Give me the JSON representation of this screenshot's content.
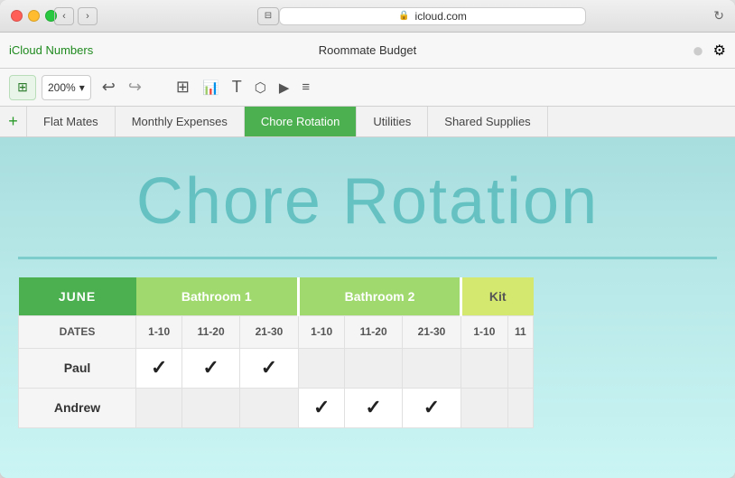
{
  "window": {
    "title": "Roommate Budget",
    "url": "icloud.com",
    "app_brand": "iCloud Numbers"
  },
  "toolbar": {
    "zoom_value": "200%",
    "undo_label": "↩",
    "redo_label": "↪",
    "add_sheet_label": "+"
  },
  "tabs": [
    {
      "id": "flat-mates",
      "label": "Flat Mates",
      "active": false
    },
    {
      "id": "monthly-expenses",
      "label": "Monthly Expenses",
      "active": false
    },
    {
      "id": "chore-rotation",
      "label": "Chore Rotation",
      "active": true
    },
    {
      "id": "utilities",
      "label": "Utilities",
      "active": false
    },
    {
      "id": "shared-supplies",
      "label": "Shared Supplies",
      "active": false
    }
  ],
  "sheet": {
    "title": "Chore Rotation",
    "table": {
      "month_header": "JUNE",
      "columns": [
        {
          "id": "bathroom1",
          "label": "Bathroom 1",
          "subheadings": [
            "1-10",
            "11-20",
            "21-30"
          ]
        },
        {
          "id": "bathroom2",
          "label": "Bathroom 2",
          "subheadings": [
            "1-10",
            "11-20",
            "21-30"
          ]
        },
        {
          "id": "kit",
          "label": "Kit",
          "subheadings": [
            "1-10",
            "11"
          ]
        }
      ],
      "dates_label": "DATES",
      "rows": [
        {
          "name": "Paul",
          "data": [
            true,
            true,
            true,
            false,
            false,
            false,
            false,
            false
          ]
        },
        {
          "name": "Andrew",
          "data": [
            false,
            false,
            false,
            true,
            true,
            true,
            false,
            false
          ]
        }
      ]
    }
  },
  "icons": {
    "table": "⊞",
    "chart": "📊",
    "text_insert": "T",
    "shape": "○",
    "media": "▶",
    "comment": "≡",
    "account": "●",
    "wrench": "⚙",
    "undo": "↩",
    "redo": "↪",
    "lock": "🔒",
    "back_arrow": "‹",
    "forward_arrow": "›",
    "chevron_down": "▾",
    "reload": "↻",
    "plus": "+"
  },
  "colors": {
    "tab_active_bg": "#4caf50",
    "tab_active_text": "#ffffff",
    "june_header_bg": "#4caf50",
    "bathroom_header_bg": "#8ecf4a",
    "kit_header_bg": "#c8e050",
    "title_color": "rgba(70,180,180,0.65)",
    "bg_gradient_top": "#a8dede",
    "bg_gradient_bottom": "#caf2f0"
  }
}
